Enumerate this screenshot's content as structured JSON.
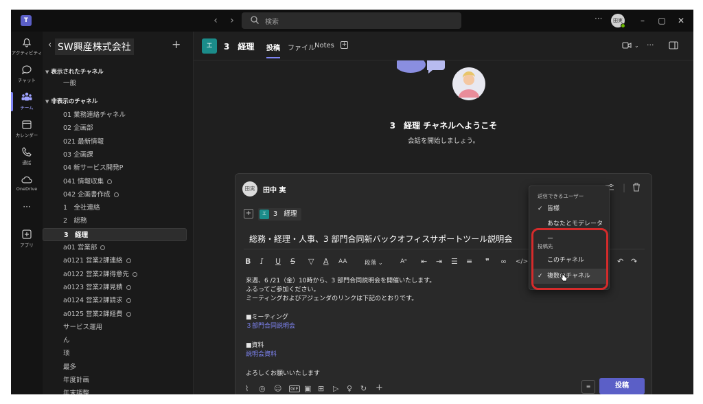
{
  "titlebar": {
    "search_placeholder": "検索",
    "more": "···",
    "avatar_initials": "田実"
  },
  "rail": [
    {
      "label": "アクティビティ",
      "icon": "bell-icon"
    },
    {
      "label": "チャット",
      "icon": "chat-icon"
    },
    {
      "label": "チーム",
      "icon": "teams-icon"
    },
    {
      "label": "カレンダー",
      "icon": "calendar-icon"
    },
    {
      "label": "通話",
      "icon": "phone-icon"
    },
    {
      "label": "OneDrive",
      "icon": "cloud-icon"
    },
    {
      "label": "···",
      "icon": "more-icon"
    },
    {
      "label": "アプリ",
      "icon": "apps-icon"
    }
  ],
  "sidebar": {
    "team_name": "SW興産株式会社",
    "visible_section": "表示されたチャネル",
    "hidden_section": "非表示のチャネル",
    "visible_channels": [
      "一般"
    ],
    "hidden_channels": [
      {
        "name": "01 業務連絡チャネル",
        "private": false
      },
      {
        "name": "02 企画部",
        "private": false
      },
      {
        "name": "021 最新情報",
        "private": false
      },
      {
        "name": "03 企画課",
        "private": false
      },
      {
        "name": "04 新サービス開発P",
        "private": false
      },
      {
        "name": "041 情報収集",
        "private": true
      },
      {
        "name": "042 企画書作成",
        "private": true
      },
      {
        "name": "1　全社連絡",
        "private": false
      },
      {
        "name": "2　総務",
        "private": false
      },
      {
        "name": "3　経理",
        "private": false,
        "active": true
      },
      {
        "name": "a01 営業部",
        "private": true
      },
      {
        "name": "a0121 営業2課連絡",
        "private": true
      },
      {
        "name": "a0122 営業2課得意先",
        "private": true
      },
      {
        "name": "a0123 営業2課見積",
        "private": true
      },
      {
        "name": "a0124 営業2課請求",
        "private": true
      },
      {
        "name": "a0125 営業2課経費",
        "private": true
      },
      {
        "name": "サービス運用",
        "private": false
      },
      {
        "name": "ん",
        "private": false
      },
      {
        "name": "顼",
        "private": false
      },
      {
        "name": "最多",
        "private": false
      },
      {
        "name": "年度計画",
        "private": false
      },
      {
        "name": "年末調整",
        "private": false
      }
    ]
  },
  "channel": {
    "avatar": "エ",
    "title": "3　経理",
    "tabs": [
      "投稿",
      "ファイル",
      "Notes"
    ]
  },
  "welcome": {
    "title": "3　経理 チャネルへようこそ",
    "subtitle": "会話を開始しましょう。"
  },
  "compose": {
    "author_initials": "田実",
    "author": "田中 実",
    "post_to_chip": "3　経理",
    "chip_avatar": "エ",
    "subject": "総務・経理・人事、3 部門合同新バックオフィスサポートツール説明会",
    "toolbar_paragraph": "段落",
    "body": [
      {
        "text": "来週、6 /21（金）10時から、3 部門合同説明会を開催いたします。",
        "link": false
      },
      {
        "text": "ふるってご参加ください。",
        "link": false
      },
      {
        "text": "ミーティングおよびアジェンダのリンクは下記のとおりです。",
        "link": false
      },
      {
        "text": "■ミーティング",
        "link": false
      },
      {
        "text": "３部門合同説明会",
        "link": true
      },
      {
        "text": "■資料",
        "link": false
      },
      {
        "text": "説明会資料",
        "link": true
      },
      {
        "text": "よろしくお願いいたします",
        "link": false
      }
    ],
    "send_label": "投稿"
  },
  "dropdown": {
    "reply_header": "返信できるユーザー",
    "reply_options": [
      {
        "label": "皆様",
        "checked": true
      },
      {
        "label": "あなたとモデレーター",
        "checked": false
      }
    ],
    "post_header": "投稿先",
    "post_options": [
      {
        "label": "このチャネル",
        "checked": false
      },
      {
        "label": "複数のチャネル",
        "checked": true
      }
    ]
  },
  "colors": {
    "accent": "#5b5fc7",
    "highlight": "#d52b2b",
    "channel_avatar": "#1b8c8a"
  }
}
